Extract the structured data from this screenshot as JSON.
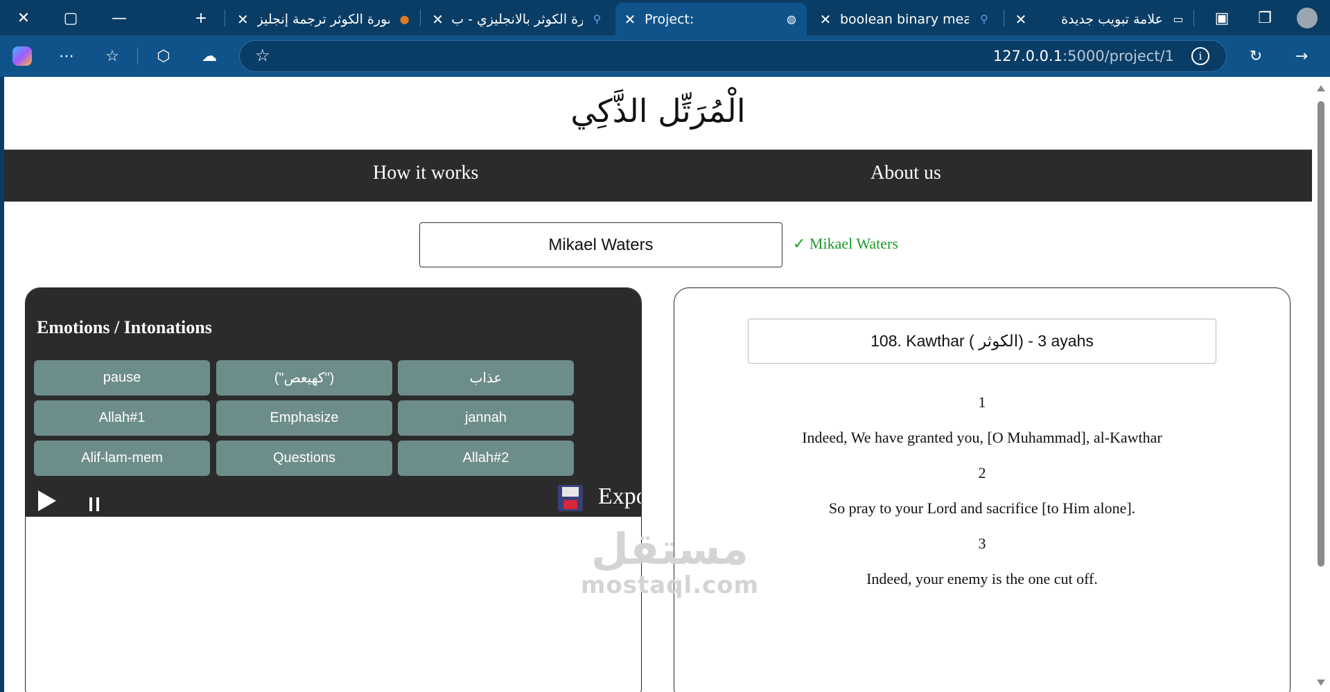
{
  "browser": {
    "tabs": [
      {
        "title": "سورة الكوثر ترجمة إنجليز"
      },
      {
        "title": "سورة الكوثر بالانجليزي - ب"
      },
      {
        "title": "Project:"
      },
      {
        "title": "boolean binary meaning"
      },
      {
        "title": "علامة تبويب جديدة"
      }
    ],
    "url_host": "127.0.0.1",
    "url_path": ":5000/project/1",
    "colors": {
      "frame": "#0a3d66",
      "toolbar": "#10538a"
    }
  },
  "page": {
    "logo": "الْمُرَتِّل الذَّكِي",
    "nav": {
      "how": "How it works",
      "about": "About us"
    },
    "name_value": "Mikael Waters",
    "name_ok": "✓ Mikael Waters",
    "emotions": {
      "title": "Emotions / Intonations",
      "buttons": [
        "pause",
        "(\"كهيعص\")",
        "عذاب",
        "Allah#1",
        "Emphasize",
        "jannah",
        "Alif-lam-mem",
        "Questions",
        "Allah#2"
      ],
      "export": "Export"
    },
    "surah": {
      "header": "108. Kawthar ( الكوثر) - 3 ayahs",
      "ayahs": [
        {
          "n": "1",
          "text": "Indeed, We have granted you, [O Muhammad], al-Kawthar"
        },
        {
          "n": "2",
          "text": "So pray to your Lord and sacrifice [to Him alone]."
        },
        {
          "n": "3",
          "text": "Indeed, your enemy is the one cut off."
        }
      ]
    },
    "watermark": {
      "ar": "مستقل",
      "en": "mostaql.com"
    }
  }
}
